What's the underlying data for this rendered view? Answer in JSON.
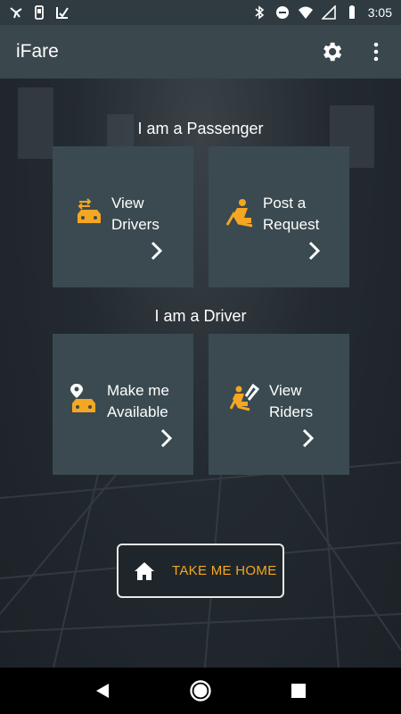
{
  "status_bar": {
    "time": "3:05",
    "left_icons": [
      "pinwheel-icon",
      "phone-icon",
      "download-check-icon"
    ],
    "right_icons": [
      "bluetooth-icon",
      "do-not-disturb-icon",
      "wifi-icon",
      "signal-icon",
      "battery-icon"
    ]
  },
  "app_bar": {
    "title": "iFare",
    "actions": [
      "settings-gear-icon",
      "more-vert-icon"
    ]
  },
  "passenger": {
    "heading": "I am a Passenger",
    "tiles": [
      {
        "label": "View\nDrivers",
        "icon": "swap-car-icon"
      },
      {
        "label": "Post a\nRequest",
        "icon": "seat-passenger-icon"
      }
    ]
  },
  "driver": {
    "heading": "I am a Driver",
    "tiles": [
      {
        "label": "Make me\nAvailable",
        "icon": "car-location-icon"
      },
      {
        "label": "View\nRiders",
        "icon": "rider-check-icon"
      }
    ]
  },
  "home_button": {
    "label": "TAKE ME HOME",
    "icon": "home-icon"
  },
  "nav_bar": {
    "buttons": [
      "back-icon",
      "home-nav-icon",
      "recents-icon"
    ]
  },
  "colors": {
    "accent": "#f5a623",
    "tile": "#3a4a50",
    "app_bar": "#3a474c",
    "status_bar": "#2f3b40"
  }
}
